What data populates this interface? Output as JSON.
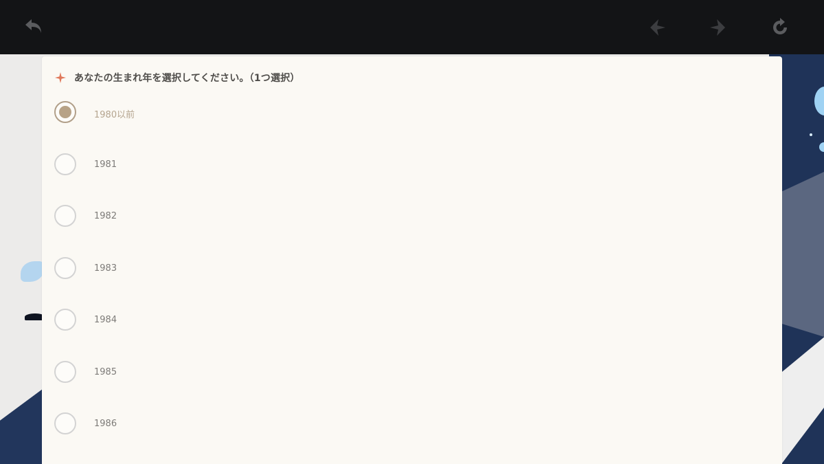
{
  "toolbar": {
    "back_icon": "back-arrow-icon",
    "prev_icon": "previous-icon",
    "next_icon": "next-icon",
    "reload_icon": "reload-icon"
  },
  "question": {
    "text": "あなたの生まれ年を選択してください。（1つ選択）",
    "icon": "sparkle-icon",
    "accent_color": "#e0785a"
  },
  "options": [
    {
      "label": "1980以前",
      "selected": true
    },
    {
      "label": "1981",
      "selected": false
    },
    {
      "label": "1982",
      "selected": false
    },
    {
      "label": "1983",
      "selected": false
    },
    {
      "label": "1984",
      "selected": false
    },
    {
      "label": "1985",
      "selected": false
    },
    {
      "label": "1986",
      "selected": false
    }
  ],
  "colors": {
    "topbar": "#131416",
    "card": "#fbf9f4",
    "selected": "#b7a286"
  }
}
